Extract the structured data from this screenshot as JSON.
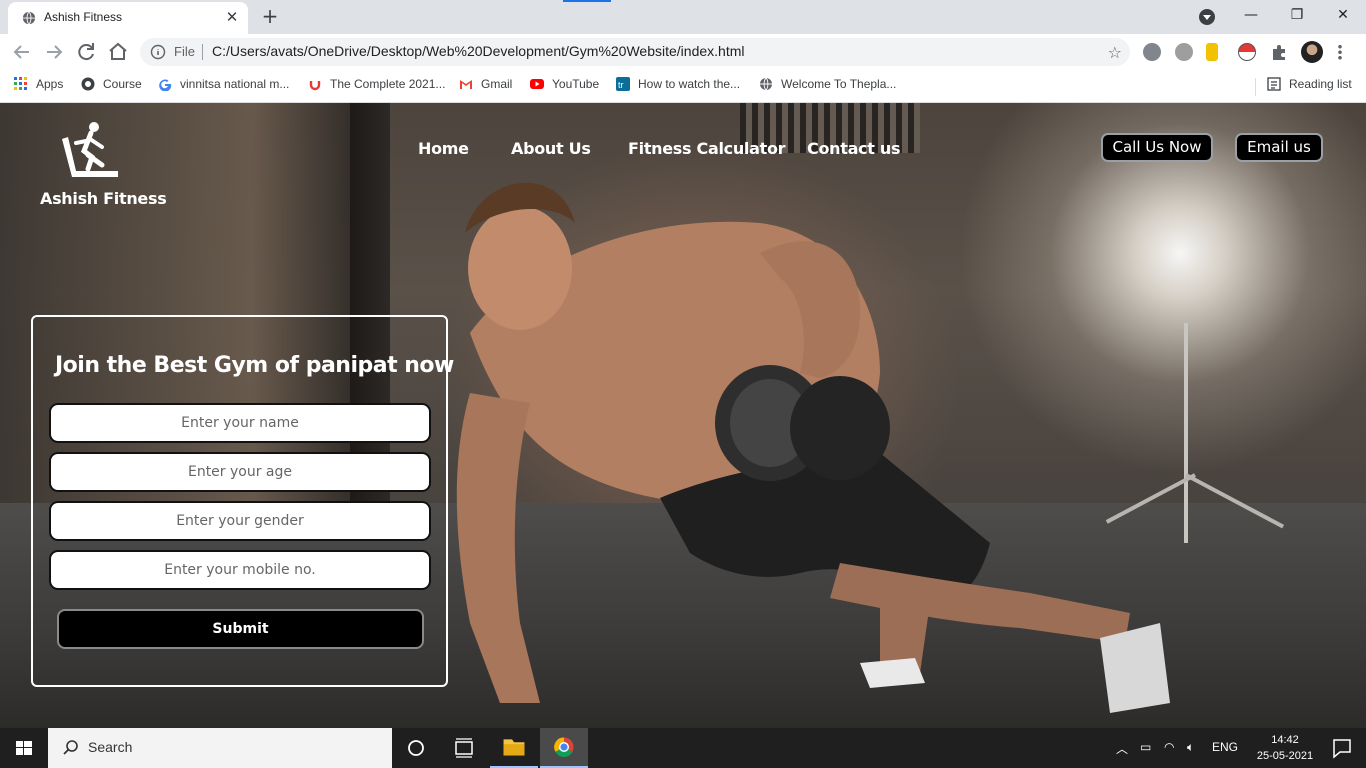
{
  "browser": {
    "tab_title": "Ashish Fitness",
    "tab_close": "✕",
    "new_tab": "+",
    "window_controls": {
      "minimize": "—",
      "maximize": "❐",
      "close": "✕"
    },
    "address_scheme": "File",
    "address_url": "C:/Users/avats/OneDrive/Desktop/Web%20Development/Gym%20Website/index.html",
    "bookmarks": [
      {
        "label": "Apps",
        "icon": "apps-grid-icon"
      },
      {
        "label": "Course",
        "icon": "course-icon"
      },
      {
        "label": "vinnitsa national m...",
        "icon": "google-icon"
      },
      {
        "label": "The Complete 2021...",
        "icon": "udemy-icon"
      },
      {
        "label": "Gmail",
        "icon": "gmail-icon"
      },
      {
        "label": "YouTube",
        "icon": "youtube-icon"
      },
      {
        "label": "How to watch the...",
        "icon": "trello-icon"
      },
      {
        "label": "Welcome To Thepla...",
        "icon": "globe-icon"
      }
    ],
    "reading_list": "Reading list"
  },
  "site": {
    "brand": "Ashish Fitness",
    "nav": [
      "Home",
      "About Us",
      "Fitness Calculator",
      "Contact us"
    ],
    "call_button": "Call Us Now",
    "email_button": "Email us",
    "form": {
      "title": "Join the Best Gym of panipat now",
      "name_placeholder": "Enter your name",
      "age_placeholder": "Enter your age",
      "gender_placeholder": "Enter your gender",
      "mobile_placeholder": "Enter your mobile no.",
      "submit_label": "Submit"
    }
  },
  "taskbar": {
    "search_label": "Search",
    "language": "ENG",
    "time": "14:42",
    "date": "25-05-2021"
  },
  "colors": {
    "accent_tab_line": "#1a73e8",
    "button_bg": "#000000",
    "text_white": "#ffffff"
  }
}
